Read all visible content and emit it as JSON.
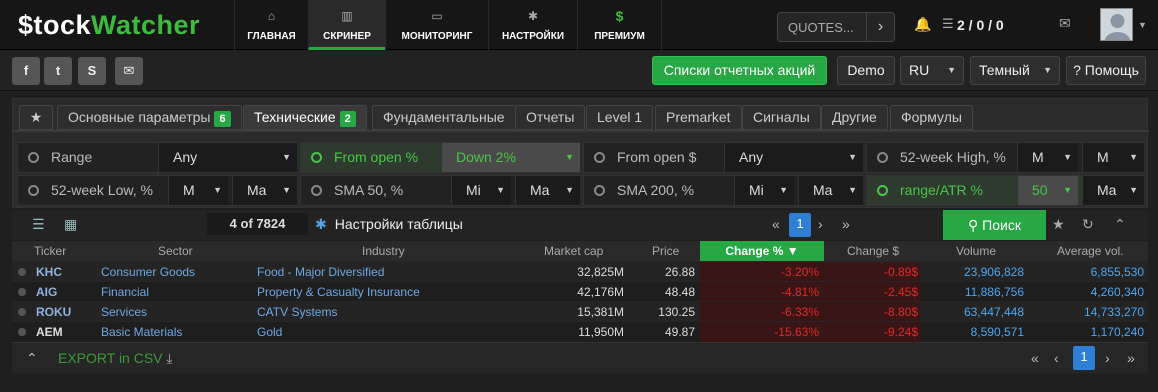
{
  "logo": {
    "part1": "$tock",
    "part2": "Watcher"
  },
  "nav": [
    {
      "label": "ГЛАВНАЯ",
      "icon": "home-icon"
    },
    {
      "label": "СКРИНЕР",
      "icon": "bar-chart-icon"
    },
    {
      "label": "МОНИТОРИНГ",
      "icon": "monitor-icon"
    },
    {
      "label": "НАСТРОЙКИ",
      "icon": "gear-icon"
    },
    {
      "label": "ПРЕМИУМ",
      "icon": "dollar-icon"
    }
  ],
  "quotes": {
    "label": "QUOTES..."
  },
  "counter": "2 / 0 / 0",
  "buttons": {
    "reports": "Списки отчетных акций",
    "demo": "Demo",
    "lang": "RU",
    "theme": "Темный",
    "help": "? Помощь"
  },
  "tabs": [
    {
      "label": "Основные параметры",
      "badge": "6"
    },
    {
      "label": "Технические",
      "badge": "2"
    },
    {
      "label": "Фундаментальные"
    },
    {
      "label": "Отчеты"
    },
    {
      "label": "Level 1"
    },
    {
      "label": "Premarket"
    },
    {
      "label": "Сигналы"
    },
    {
      "label": "Другие"
    },
    {
      "label": "Формулы"
    }
  ],
  "filters": {
    "range": {
      "label": "Range",
      "value": "Any"
    },
    "from_open_pct": {
      "label": "From open %",
      "value": "Down 2%"
    },
    "from_open_usd": {
      "label": "From open $",
      "value": "Any"
    },
    "high52": {
      "label": "52-week High, %",
      "v1": "M",
      "v2": "M"
    },
    "low52": {
      "label": "52-week Low, %",
      "v1": "M",
      "v2": "Ma"
    },
    "sma50": {
      "label": "SMA 50, %",
      "v1": "Mi",
      "v2": "Ma"
    },
    "sma200": {
      "label": "SMA 200, %",
      "v1": "Mi",
      "v2": "Ma"
    },
    "range_atr": {
      "label": "range/ATR %",
      "v1": "50",
      "v2": "Ma"
    }
  },
  "toolbar": {
    "count": "4 of 7824",
    "settings": "Настройки таблицы",
    "page": "1",
    "search": "Поиск"
  },
  "table": {
    "headers": [
      "Ticker",
      "Sector",
      "Industry",
      "Market cap",
      "Price",
      "Change %",
      "Change $",
      "Volume",
      "Average vol."
    ],
    "rows": [
      [
        "KHC",
        "Consumer Goods",
        "Food - Major Diversified",
        "32,825M",
        "26.88",
        "-3.20%",
        "-0.89$",
        "23,906,828",
        "6,855,530"
      ],
      [
        "AIG",
        "Financial",
        "Property & Casualty Insurance",
        "42,176M",
        "48.48",
        "-4.81%",
        "-2.45$",
        "11,886,756",
        "4,260,340"
      ],
      [
        "ROKU",
        "Services",
        "CATV Systems",
        "15,381M",
        "130.25",
        "-6.33%",
        "-8.80$",
        "63,447,448",
        "14,733,270"
      ],
      [
        "AEM",
        "Basic Materials",
        "Gold",
        "11,950M",
        "49.87",
        "-15.63%",
        "-9.24$",
        "8,590,571",
        "1,170,240"
      ]
    ]
  },
  "footer": {
    "export": "EXPORT in CSV",
    "page": "1"
  },
  "colors": {
    "accent": "#27a844",
    "negative": "#e02828",
    "link": "#4da6f0"
  }
}
